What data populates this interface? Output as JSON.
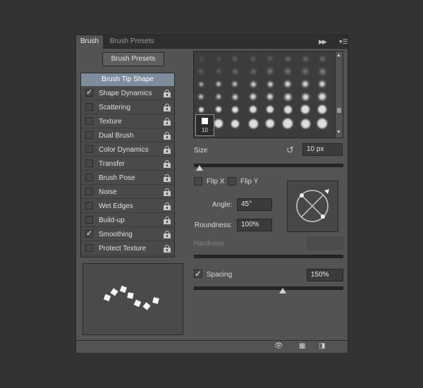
{
  "tabs": {
    "brush": "Brush",
    "presets": "Brush Presets"
  },
  "toolbar_icons": {
    "flyout": "double-arrow-icon",
    "menu": "panel-menu-icon"
  },
  "presets_button": "Brush Presets",
  "options": {
    "header": "Brush Tip Shape",
    "items": [
      {
        "label": "Shape Dynamics",
        "checked": true
      },
      {
        "label": "Scattering",
        "checked": false
      },
      {
        "label": "Texture",
        "checked": false
      },
      {
        "label": "Dual Brush",
        "checked": false
      },
      {
        "label": "Color Dynamics",
        "checked": false
      },
      {
        "label": "Transfer",
        "checked": false
      },
      {
        "label": "Brush Pose",
        "checked": false
      },
      {
        "label": "Noise",
        "checked": false
      },
      {
        "label": "Wet Edges",
        "checked": false
      },
      {
        "label": "Build-up",
        "checked": false
      },
      {
        "label": "Smoothing",
        "checked": true
      },
      {
        "label": "Protect Texture",
        "checked": false
      }
    ]
  },
  "tips": {
    "selected_size": "10"
  },
  "size": {
    "label": "Size",
    "value": "10 px",
    "slider_fraction": 0.04
  },
  "flip": {
    "x": "Flip X",
    "y": "Flip Y"
  },
  "angle": {
    "label": "Angle:",
    "value": "45°"
  },
  "roundness": {
    "label": "Roundness:",
    "value": "100%"
  },
  "hardness": {
    "label": "Hardness",
    "value": ""
  },
  "spacing": {
    "label": "Spacing",
    "value": "150%",
    "checked": true,
    "slider_fraction": 0.6
  },
  "colors": {
    "panel": "#535353",
    "selection": "#7e8c9d",
    "background": "#333333"
  }
}
